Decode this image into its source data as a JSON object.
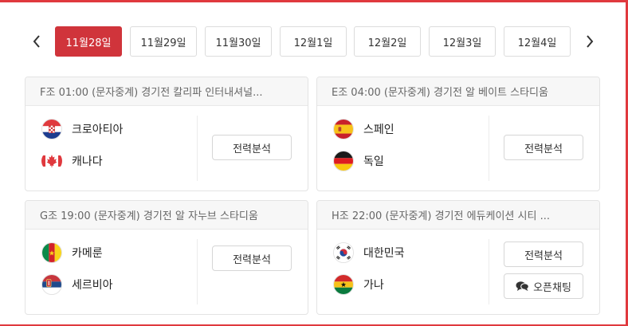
{
  "date_nav": {
    "prev_icon": "chevron-left-icon",
    "next_icon": "chevron-right-icon",
    "dates": [
      "11월28일",
      "11월29일",
      "11월30일",
      "12월1일",
      "12월2일",
      "12월3일",
      "12월4일"
    ],
    "active_index": 0
  },
  "colors": {
    "accent": "#d0343b",
    "border": "#e3e3e3",
    "header_bg": "#f7f7f7"
  },
  "matches": [
    {
      "header": "F조 01:00 (문자중계) 경기전   칼리파 인터내셔널...",
      "teams": [
        {
          "name": "크로아티아",
          "flag": "croatia-flag-icon"
        },
        {
          "name": "캐나다",
          "flag": "canada-flag-icon"
        }
      ],
      "analysis_label": "전력분석"
    },
    {
      "header": "E조 04:00 (문자중계) 경기전   알 베이트 스타디움",
      "teams": [
        {
          "name": "스페인",
          "flag": "spain-flag-icon"
        },
        {
          "name": "독일",
          "flag": "germany-flag-icon"
        }
      ],
      "analysis_label": "전력분석"
    },
    {
      "header": "G조 19:00 (문자중계) 경기전   알 자누브 스타디움",
      "teams": [
        {
          "name": "카메룬",
          "flag": "cameroon-flag-icon"
        },
        {
          "name": "세르비아",
          "flag": "serbia-flag-icon"
        }
      ],
      "analysis_label": "전력분석"
    },
    {
      "header": "H조 22:00 (문자중계) 경기전   에듀케이션 시티 ...",
      "teams": [
        {
          "name": "대한민국",
          "flag": "korea-flag-icon"
        },
        {
          "name": "가나",
          "flag": "ghana-flag-icon"
        }
      ],
      "analysis_label": "전력분석",
      "chat_label": "오픈채팅",
      "chat_icon": "chat-bubbles-icon"
    }
  ]
}
